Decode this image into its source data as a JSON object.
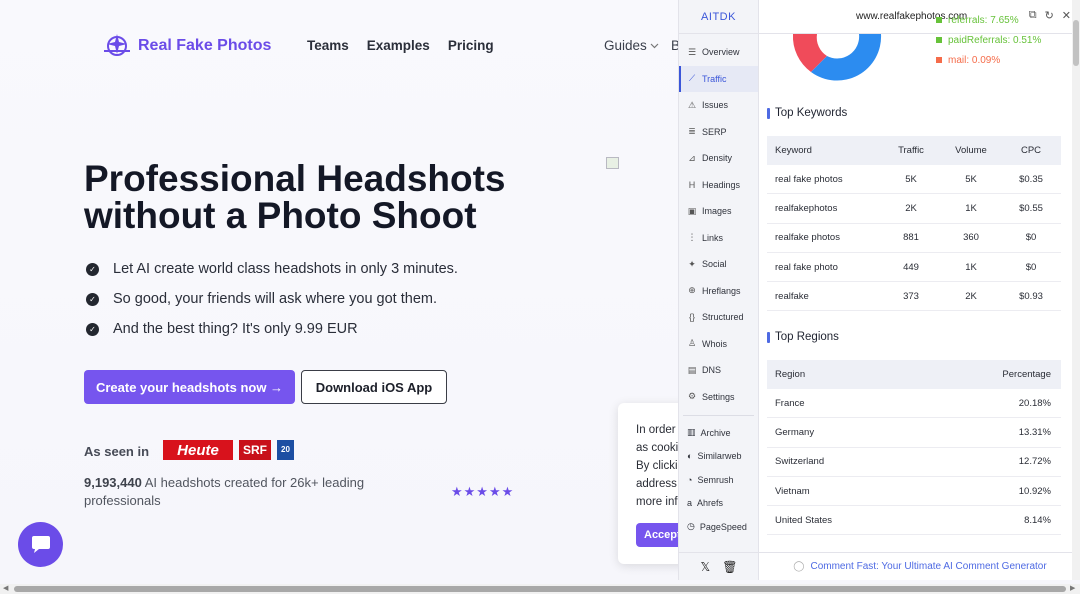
{
  "site": {
    "logo_text": "Real Fake Photos",
    "nav": [
      "Teams",
      "Examples",
      "Pricing"
    ],
    "nav_guides": "Guides",
    "nav_b": "B",
    "hero_title": "Professional Headshots without a Photo Shoot",
    "bullets": [
      "Let AI create world class headshots in only 3 minutes.",
      "So good, your friends will ask where you got them.",
      "And the best thing? It's only 9.99 EUR"
    ],
    "cta_primary": "Create your headshots now →",
    "cta_secondary": "Download iOS App",
    "seen_in": "As seen in",
    "brands": [
      "Heute",
      "SRF",
      "20"
    ],
    "count_number": "9,193,440",
    "count_text": "AI headshots created for 26k+ leading professionals",
    "stars": "★★★★★",
    "rating": 5,
    "cookie_lines": [
      "In order",
      "as cooki",
      "By clickin",
      "address",
      "more inf"
    ],
    "cookie_button": "Accept"
  },
  "extension": {
    "brand": "AITDK",
    "url": "www.realfakephotos.com",
    "nav": [
      {
        "label": "Overview",
        "icon": "list-icon"
      },
      {
        "label": "Traffic",
        "icon": "chart-icon",
        "active": true
      },
      {
        "label": "Issues",
        "icon": "warning-icon"
      },
      {
        "label": "SERP",
        "icon": "serp-icon"
      },
      {
        "label": "Density",
        "icon": "density-icon"
      },
      {
        "label": "Headings",
        "icon": "heading-icon"
      },
      {
        "label": "Images",
        "icon": "image-icon"
      },
      {
        "label": "Links",
        "icon": "link-icon"
      },
      {
        "label": "Social",
        "icon": "twitter-icon"
      },
      {
        "label": "Hreflangs",
        "icon": "globe-icon"
      },
      {
        "label": "Structured",
        "icon": "braces-icon"
      },
      {
        "label": "Whois",
        "icon": "user-icon"
      },
      {
        "label": "DNS",
        "icon": "server-icon"
      },
      {
        "label": "Settings",
        "icon": "gear-icon"
      }
    ],
    "tools": [
      {
        "label": "Archive",
        "icon": "archive-icon"
      },
      {
        "label": "Similarweb",
        "icon": "similarweb-icon"
      },
      {
        "label": "Semrush",
        "icon": "semrush-icon"
      },
      {
        "label": "Ahrefs",
        "icon": "ahrefs-icon"
      },
      {
        "label": "PageSpeed",
        "icon": "pagespeed-icon"
      }
    ],
    "legend": [
      {
        "label": "referrals: 7.65%",
        "color": "#67c23a"
      },
      {
        "label": "paidReferrals: 0.51%",
        "color": "#67c23a"
      },
      {
        "label": "mail: 0.09%",
        "color": "#f56c4a"
      }
    ],
    "donut_colors": [
      "#f04b5a",
      "#2c8cf0"
    ],
    "keywords_title": "Top Keywords",
    "keywords_headers": [
      "Keyword",
      "Traffic",
      "Volume",
      "CPC"
    ],
    "keywords": [
      [
        "real fake photos",
        "5K",
        "5K",
        "$0.35"
      ],
      [
        "realfakephotos",
        "2K",
        "1K",
        "$0.55"
      ],
      [
        "realfake photos",
        "881",
        "360",
        "$0"
      ],
      [
        "real fake photo",
        "449",
        "1K",
        "$0"
      ],
      [
        "realfake",
        "373",
        "2K",
        "$0.93"
      ]
    ],
    "regions_title": "Top Regions",
    "regions_headers": [
      "Region",
      "Percentage"
    ],
    "regions": [
      [
        "France",
        "20.18%"
      ],
      [
        "Germany",
        "13.31%"
      ],
      [
        "Switzerland",
        "12.72%"
      ],
      [
        "Vietnam",
        "10.92%"
      ],
      [
        "United States",
        "8.14%"
      ]
    ],
    "footer_link": "Comment Fast: Your Ultimate AI Comment Generator"
  }
}
